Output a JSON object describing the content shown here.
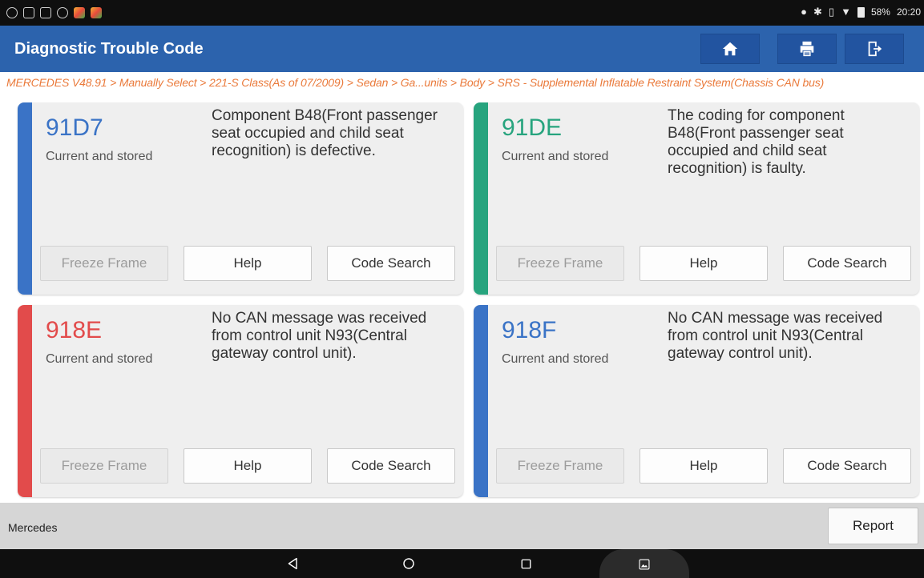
{
  "status_bar": {
    "battery": "58%",
    "time": "20:20"
  },
  "header": {
    "title": "Diagnostic Trouble Code",
    "icons": [
      "home-icon",
      "print-icon",
      "exit-icon"
    ]
  },
  "breadcrumb": "MERCEDES V48.91 > Manually Select > 221-S Class(As of 07/2009) > Sedan > Ga...units > Body > SRS - Supplemental Inflatable Restraint System(Chassis CAN bus)",
  "buttons": {
    "freeze_frame": "Freeze Frame",
    "help": "Help",
    "code_search": "Code Search"
  },
  "dtcs": [
    {
      "code": "91D7",
      "status": "Current and stored",
      "description": "Component B48(Front passenger seat occupied and child seat recognition) is defective.",
      "color": "#3a73c6"
    },
    {
      "code": "91DE",
      "status": "Current and stored",
      "description": "The coding for component B48(Front passenger seat occupied and child seat recognition) is faulty.",
      "color": "#27a47e"
    },
    {
      "code": "918E",
      "status": "Current and stored",
      "description": "No CAN message was received from control unit N93(Central gateway control unit).",
      "color": "#e24b4b"
    },
    {
      "code": "918F",
      "status": "Current and stored",
      "description": "No CAN message was received from control unit N93(Central gateway control unit).",
      "color": "#3a73c6"
    }
  ],
  "footer": {
    "brand": "Mercedes",
    "report_label": "Report"
  }
}
